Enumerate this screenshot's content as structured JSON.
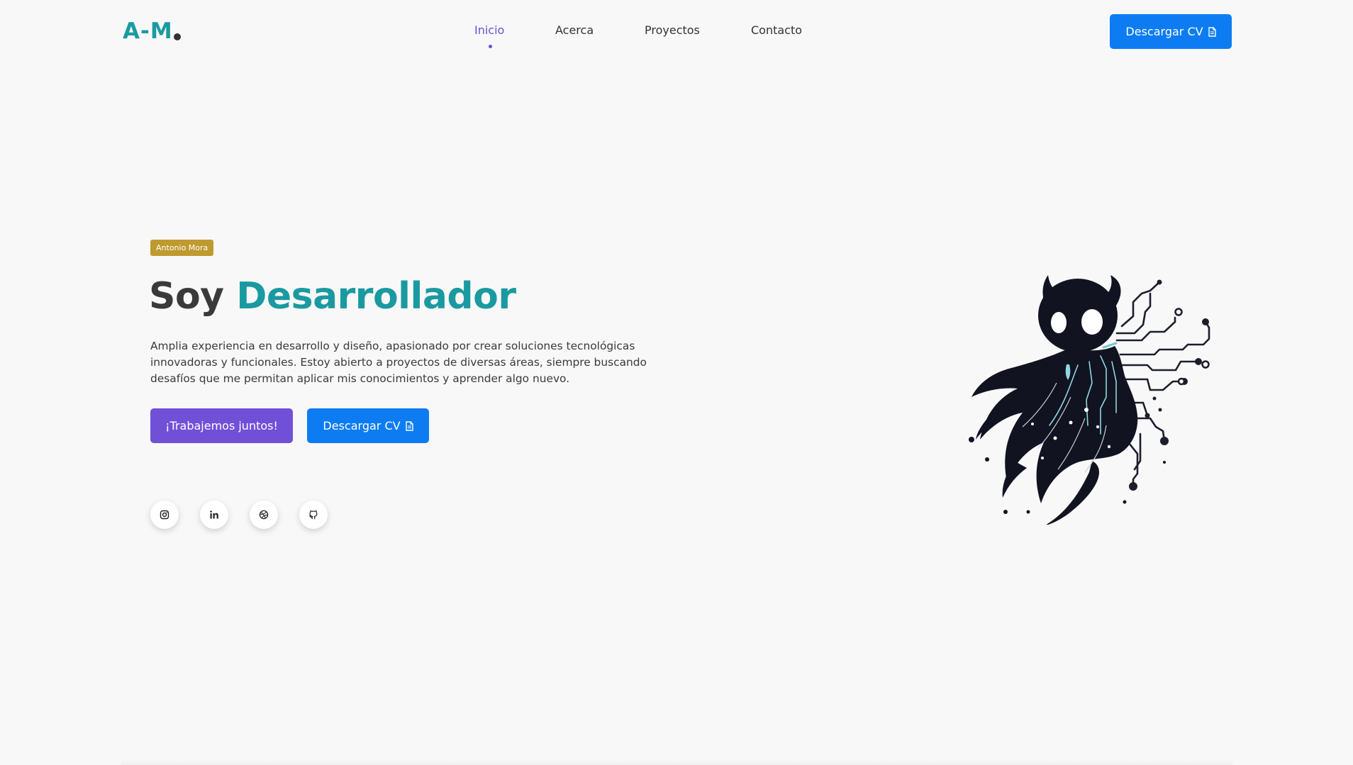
{
  "brand": {
    "logo_text": "A-M",
    "logo_color": "#1a9aa0"
  },
  "nav": {
    "items": [
      {
        "label": "Inicio",
        "active": true
      },
      {
        "label": "Acerca",
        "active": false
      },
      {
        "label": "Proyectos",
        "active": false
      },
      {
        "label": "Contacto",
        "active": false
      }
    ],
    "active_color": "#6a4fd6",
    "cta": {
      "label": "Descargar CV",
      "icon": "document-icon"
    }
  },
  "hero": {
    "badge": "Antonio Mora",
    "headline_prefix": "Soy",
    "headline_role": "Desarrollador",
    "description": "Amplia experiencia en desarrollo y diseño, apasionado por crear soluciones tecnológicas innovadoras y funcionales. Estoy abierto a proyectos de diversas áreas, siempre buscando desafíos que me permitan aplicar mis conocimientos y aprender algo nuevo.",
    "buttons": {
      "primary": "¡Trabajemos juntos!",
      "secondary": "Descargar CV"
    },
    "socials": [
      {
        "name": "instagram",
        "icon": "instagram-icon"
      },
      {
        "name": "linkedin",
        "icon": "linkedin-icon"
      },
      {
        "name": "dribbble",
        "icon": "dribbble-icon"
      },
      {
        "name": "github",
        "icon": "github-icon"
      }
    ],
    "illustration": "hollow-knight-circuit-illustration"
  },
  "colors": {
    "accent_teal": "#1a9aa0",
    "primary_blue": "#0d7cf2",
    "purple": "#7150d8",
    "badge_gold": "#bf9a2f",
    "background": "#f8f8f9"
  }
}
